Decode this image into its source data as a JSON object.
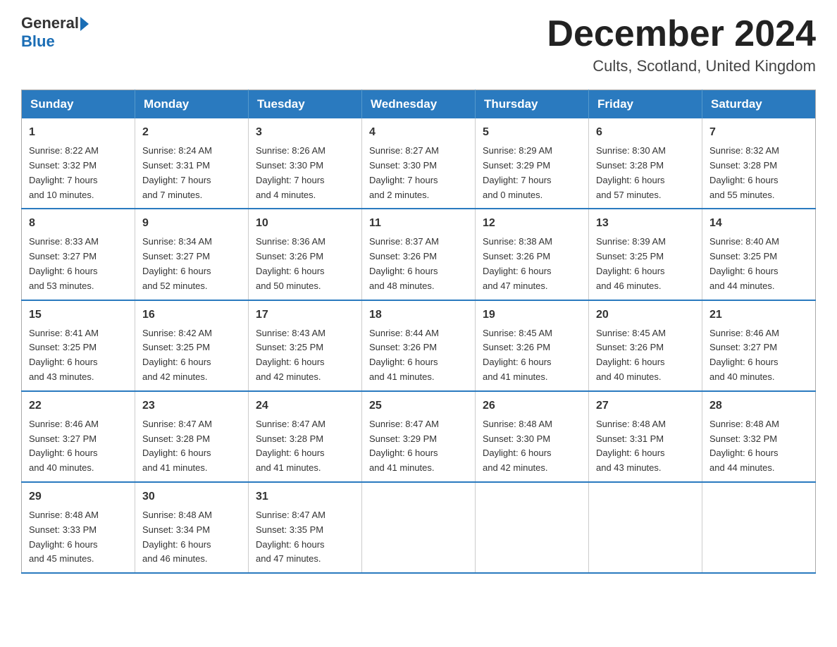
{
  "header": {
    "logo_line1": "General",
    "logo_line2": "Blue",
    "month_title": "December 2024",
    "location": "Cults, Scotland, United Kingdom"
  },
  "days_of_week": [
    "Sunday",
    "Monday",
    "Tuesday",
    "Wednesday",
    "Thursday",
    "Friday",
    "Saturday"
  ],
  "weeks": [
    [
      {
        "day": "1",
        "info": "Sunrise: 8:22 AM\nSunset: 3:32 PM\nDaylight: 7 hours\nand 10 minutes."
      },
      {
        "day": "2",
        "info": "Sunrise: 8:24 AM\nSunset: 3:31 PM\nDaylight: 7 hours\nand 7 minutes."
      },
      {
        "day": "3",
        "info": "Sunrise: 8:26 AM\nSunset: 3:30 PM\nDaylight: 7 hours\nand 4 minutes."
      },
      {
        "day": "4",
        "info": "Sunrise: 8:27 AM\nSunset: 3:30 PM\nDaylight: 7 hours\nand 2 minutes."
      },
      {
        "day": "5",
        "info": "Sunrise: 8:29 AM\nSunset: 3:29 PM\nDaylight: 7 hours\nand 0 minutes."
      },
      {
        "day": "6",
        "info": "Sunrise: 8:30 AM\nSunset: 3:28 PM\nDaylight: 6 hours\nand 57 minutes."
      },
      {
        "day": "7",
        "info": "Sunrise: 8:32 AM\nSunset: 3:28 PM\nDaylight: 6 hours\nand 55 minutes."
      }
    ],
    [
      {
        "day": "8",
        "info": "Sunrise: 8:33 AM\nSunset: 3:27 PM\nDaylight: 6 hours\nand 53 minutes."
      },
      {
        "day": "9",
        "info": "Sunrise: 8:34 AM\nSunset: 3:27 PM\nDaylight: 6 hours\nand 52 minutes."
      },
      {
        "day": "10",
        "info": "Sunrise: 8:36 AM\nSunset: 3:26 PM\nDaylight: 6 hours\nand 50 minutes."
      },
      {
        "day": "11",
        "info": "Sunrise: 8:37 AM\nSunset: 3:26 PM\nDaylight: 6 hours\nand 48 minutes."
      },
      {
        "day": "12",
        "info": "Sunrise: 8:38 AM\nSunset: 3:26 PM\nDaylight: 6 hours\nand 47 minutes."
      },
      {
        "day": "13",
        "info": "Sunrise: 8:39 AM\nSunset: 3:25 PM\nDaylight: 6 hours\nand 46 minutes."
      },
      {
        "day": "14",
        "info": "Sunrise: 8:40 AM\nSunset: 3:25 PM\nDaylight: 6 hours\nand 44 minutes."
      }
    ],
    [
      {
        "day": "15",
        "info": "Sunrise: 8:41 AM\nSunset: 3:25 PM\nDaylight: 6 hours\nand 43 minutes."
      },
      {
        "day": "16",
        "info": "Sunrise: 8:42 AM\nSunset: 3:25 PM\nDaylight: 6 hours\nand 42 minutes."
      },
      {
        "day": "17",
        "info": "Sunrise: 8:43 AM\nSunset: 3:25 PM\nDaylight: 6 hours\nand 42 minutes."
      },
      {
        "day": "18",
        "info": "Sunrise: 8:44 AM\nSunset: 3:26 PM\nDaylight: 6 hours\nand 41 minutes."
      },
      {
        "day": "19",
        "info": "Sunrise: 8:45 AM\nSunset: 3:26 PM\nDaylight: 6 hours\nand 41 minutes."
      },
      {
        "day": "20",
        "info": "Sunrise: 8:45 AM\nSunset: 3:26 PM\nDaylight: 6 hours\nand 40 minutes."
      },
      {
        "day": "21",
        "info": "Sunrise: 8:46 AM\nSunset: 3:27 PM\nDaylight: 6 hours\nand 40 minutes."
      }
    ],
    [
      {
        "day": "22",
        "info": "Sunrise: 8:46 AM\nSunset: 3:27 PM\nDaylight: 6 hours\nand 40 minutes."
      },
      {
        "day": "23",
        "info": "Sunrise: 8:47 AM\nSunset: 3:28 PM\nDaylight: 6 hours\nand 41 minutes."
      },
      {
        "day": "24",
        "info": "Sunrise: 8:47 AM\nSunset: 3:28 PM\nDaylight: 6 hours\nand 41 minutes."
      },
      {
        "day": "25",
        "info": "Sunrise: 8:47 AM\nSunset: 3:29 PM\nDaylight: 6 hours\nand 41 minutes."
      },
      {
        "day": "26",
        "info": "Sunrise: 8:48 AM\nSunset: 3:30 PM\nDaylight: 6 hours\nand 42 minutes."
      },
      {
        "day": "27",
        "info": "Sunrise: 8:48 AM\nSunset: 3:31 PM\nDaylight: 6 hours\nand 43 minutes."
      },
      {
        "day": "28",
        "info": "Sunrise: 8:48 AM\nSunset: 3:32 PM\nDaylight: 6 hours\nand 44 minutes."
      }
    ],
    [
      {
        "day": "29",
        "info": "Sunrise: 8:48 AM\nSunset: 3:33 PM\nDaylight: 6 hours\nand 45 minutes."
      },
      {
        "day": "30",
        "info": "Sunrise: 8:48 AM\nSunset: 3:34 PM\nDaylight: 6 hours\nand 46 minutes."
      },
      {
        "day": "31",
        "info": "Sunrise: 8:47 AM\nSunset: 3:35 PM\nDaylight: 6 hours\nand 47 minutes."
      },
      {
        "day": "",
        "info": ""
      },
      {
        "day": "",
        "info": ""
      },
      {
        "day": "",
        "info": ""
      },
      {
        "day": "",
        "info": ""
      }
    ]
  ]
}
